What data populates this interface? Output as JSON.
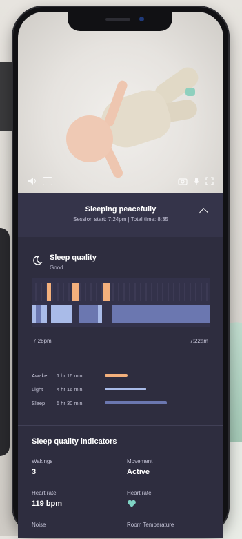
{
  "video": {
    "left_icons": [
      "volume-icon",
      "hd-icon"
    ],
    "right_icons": [
      "camera-icon",
      "mic-icon",
      "fullscreen-icon"
    ]
  },
  "status": {
    "title": "Sleeping peacefully",
    "subtitle": "Session start: 7:24pm | Total time: 8:35"
  },
  "sleep_quality": {
    "title": "Sleep quality",
    "value": "Good"
  },
  "timeline": {
    "start": "7:28pm",
    "end": "7:22am",
    "colors": {
      "awake": "#f3b07c",
      "light": "#a9bbe8",
      "sleep": "#6b77b0"
    }
  },
  "legend": [
    {
      "name": "Awake",
      "duration": "1 hr 16 min",
      "fraction": 0.22,
      "color": "#f3b07c"
    },
    {
      "name": "Light",
      "duration": "4 hr 16 min",
      "fraction": 0.4,
      "color": "#a9bbe8"
    },
    {
      "name": "Sleep",
      "duration": "5 hr 30 min",
      "fraction": 0.6,
      "color": "#6b77b0"
    }
  ],
  "indicators": {
    "title": "Sleep quality indicators",
    "items": [
      {
        "label": "Wakings",
        "value": "3"
      },
      {
        "label": "Movement",
        "value": "Active"
      },
      {
        "label": "Heart rate",
        "value": "119 bpm"
      },
      {
        "label": "Heart rate",
        "value": ""
      },
      {
        "label": "Noise",
        "value": ""
      },
      {
        "label": "Room Temperature",
        "value": ""
      }
    ]
  }
}
